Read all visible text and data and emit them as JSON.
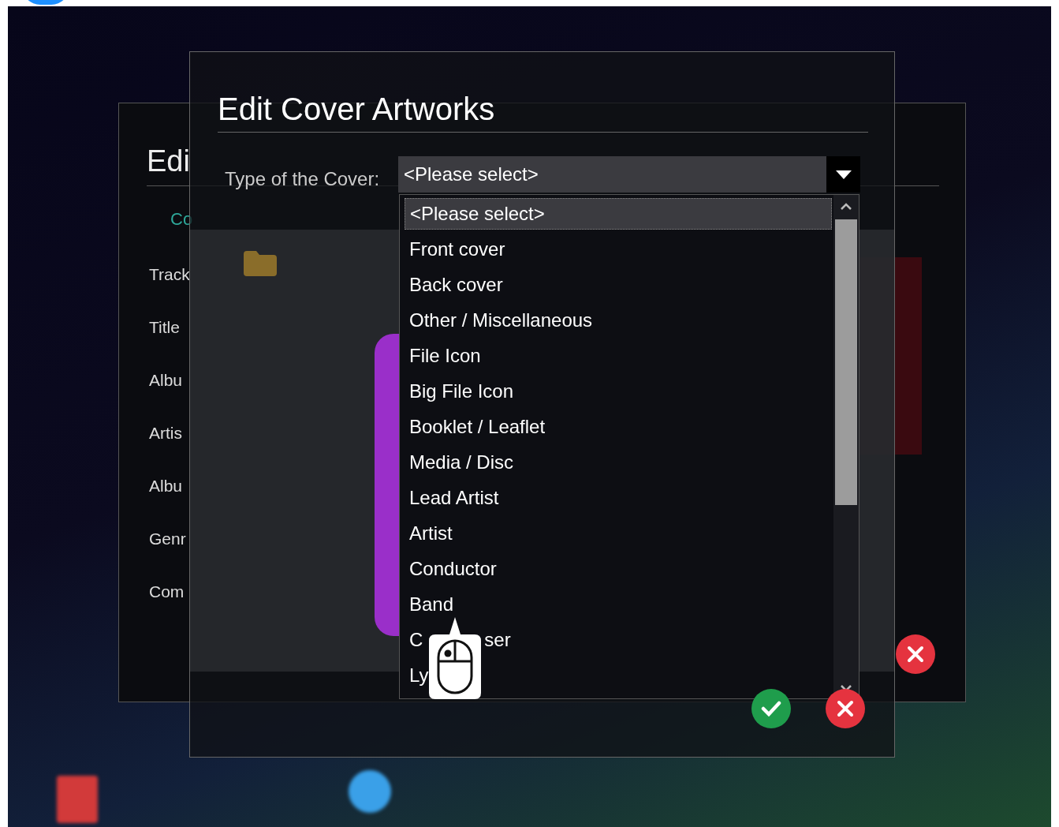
{
  "back_dialog": {
    "title": "Edi",
    "tabs": [
      {
        "label": "Co",
        "selected": true
      }
    ],
    "fields": [
      {
        "label": "Track"
      },
      {
        "label": "Title"
      },
      {
        "label": "Albu"
      },
      {
        "label": "Artis"
      },
      {
        "label": "Albu"
      },
      {
        "label": "Genr"
      },
      {
        "label": "Com"
      }
    ]
  },
  "dialog": {
    "title": "Edit Cover Artworks",
    "field_label": "Type of the Cover:",
    "combo_value": "<Please select>",
    "options": [
      {
        "label": "<Please select>",
        "selected": true
      },
      {
        "label": "Front cover",
        "selected": false
      },
      {
        "label": "Back cover",
        "selected": false
      },
      {
        "label": "Other / Miscellaneous",
        "selected": false
      },
      {
        "label": "File Icon",
        "selected": false
      },
      {
        "label": "Big File Icon",
        "selected": false
      },
      {
        "label": "Booklet / Leaflet",
        "selected": false
      },
      {
        "label": "Media / Disc",
        "selected": false
      },
      {
        "label": "Lead Artist",
        "selected": false
      },
      {
        "label": "Artist",
        "selected": false
      },
      {
        "label": "Conductor",
        "selected": false
      },
      {
        "label": "Band",
        "selected": false
      },
      {
        "label": "C",
        "label_tail": "ser",
        "selected": false
      },
      {
        "label": "Ly",
        "selected": false
      }
    ]
  }
}
